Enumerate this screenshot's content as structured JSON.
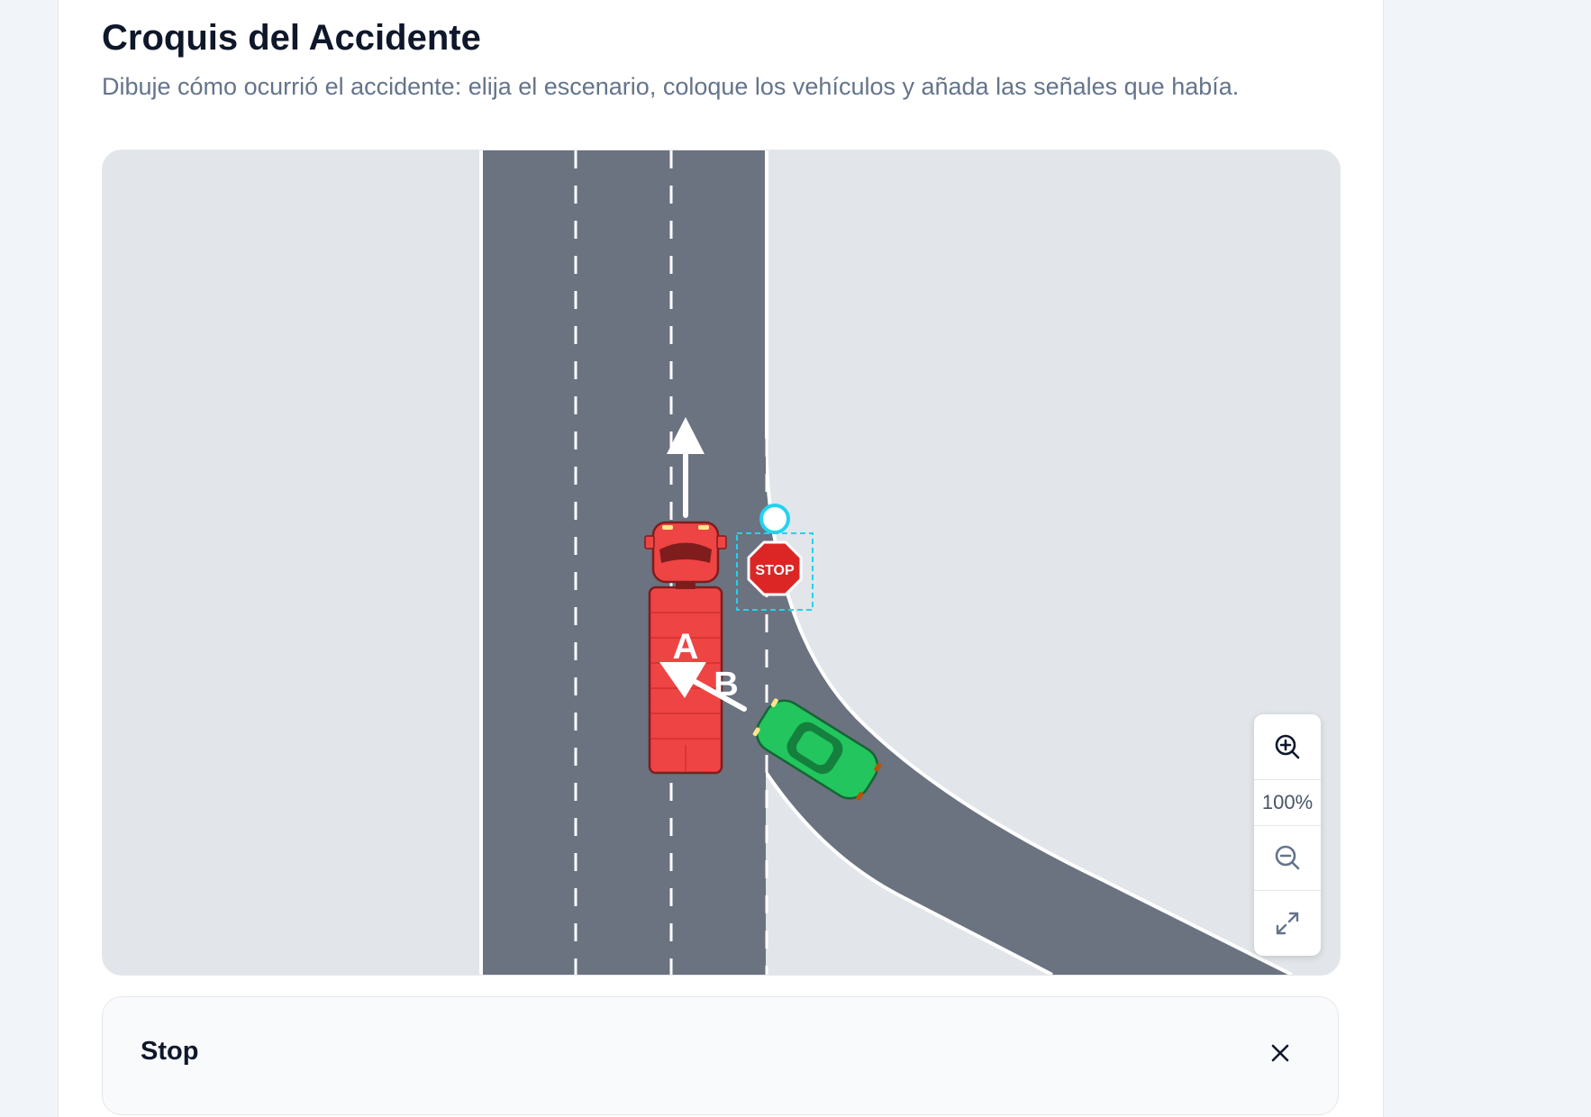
{
  "header": {
    "title": "Croquis del Accidente",
    "subtitle": "Dibuje cómo ocurrió el accidente: elija el escenario, coloque los vehículos y añada las señales que había."
  },
  "sketch": {
    "scenario": "t-junction-curved-right",
    "vehicles": [
      {
        "label": "A",
        "type": "truck",
        "color": "#ef4444",
        "heading": "north"
      },
      {
        "label": "B",
        "type": "car",
        "color": "#22c55e",
        "heading": "north-west"
      }
    ],
    "signs": [
      {
        "text": "STOP",
        "color": "#dc2626",
        "selected": true
      }
    ],
    "colors": {
      "road": "#6b7280",
      "ground": "#e2e5e9",
      "selection": "#22d3ee"
    }
  },
  "zoom": {
    "level": "100%",
    "zoom_in_icon": "zoom-in-icon",
    "zoom_out_icon": "zoom-out-icon",
    "fullscreen_icon": "expand-icon"
  },
  "selection_panel": {
    "title": "Stop",
    "close_icon": "close-icon"
  }
}
